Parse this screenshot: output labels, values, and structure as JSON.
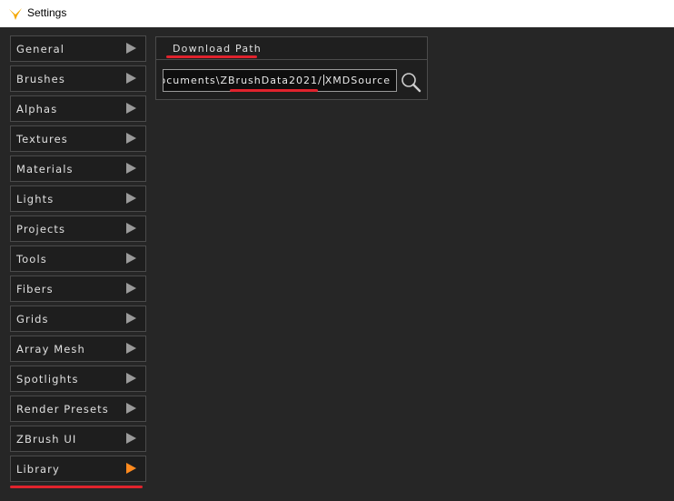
{
  "window": {
    "title": "Settings",
    "icon": "zbrush-logo-icon"
  },
  "sidebar": {
    "items": [
      {
        "label": "General"
      },
      {
        "label": "Brushes"
      },
      {
        "label": "Alphas"
      },
      {
        "label": "Textures"
      },
      {
        "label": "Materials"
      },
      {
        "label": "Lights"
      },
      {
        "label": "Projects"
      },
      {
        "label": "Tools"
      },
      {
        "label": "Fibers"
      },
      {
        "label": "Grids"
      },
      {
        "label": "Array Mesh"
      },
      {
        "label": "Spotlights"
      },
      {
        "label": "Render Presets"
      },
      {
        "label": "ZBrush UI"
      },
      {
        "label": "Library"
      }
    ],
    "active_index": 14
  },
  "download": {
    "header": "Download Path",
    "path_before": "ocuments\\ZBrushData2021/",
    "path_after": "XMDSource",
    "search_icon": "magnifier-icon"
  },
  "colors": {
    "background": "#262626",
    "accent_arrow": "#ff8a1e",
    "annotation_underline": "#e0232d"
  }
}
